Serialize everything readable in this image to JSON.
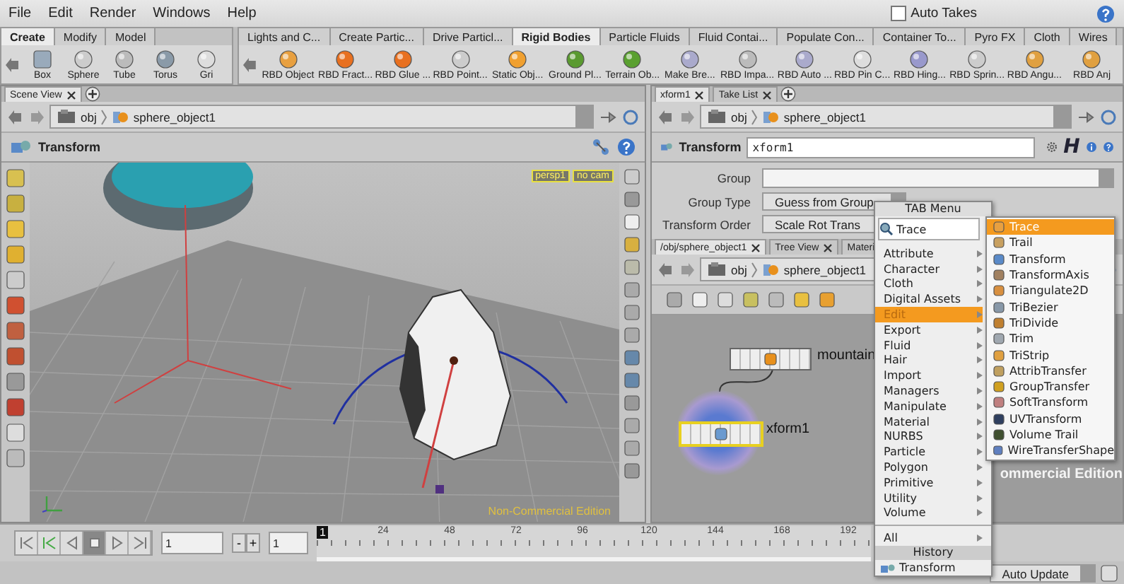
{
  "menubar": {
    "items": [
      "File",
      "Edit",
      "Render",
      "Windows",
      "Help"
    ],
    "auto_takes": {
      "label": "Auto Takes",
      "checked": false
    }
  },
  "shelf_left": {
    "tabs": [
      {
        "label": "Create",
        "selected": true
      },
      {
        "label": "Modify",
        "selected": false
      },
      {
        "label": "Model",
        "selected": false
      }
    ],
    "tools": [
      "Box",
      "Sphere",
      "Tube",
      "Torus",
      "Gri"
    ]
  },
  "shelf_right": {
    "tabs": [
      {
        "label": "Lights and C...",
        "selected": false
      },
      {
        "label": "Create Partic...",
        "selected": false
      },
      {
        "label": "Drive Particl...",
        "selected": false
      },
      {
        "label": "Rigid Bodies",
        "selected": true
      },
      {
        "label": "Particle Fluids",
        "selected": false
      },
      {
        "label": "Fluid Contai...",
        "selected": false
      },
      {
        "label": "Populate Con...",
        "selected": false
      },
      {
        "label": "Container To...",
        "selected": false
      },
      {
        "label": "Pyro FX",
        "selected": false
      },
      {
        "label": "Cloth",
        "selected": false
      },
      {
        "label": "Wires",
        "selected": false
      }
    ],
    "tools": [
      "RBD Object",
      "RBD Fract...",
      "RBD Glue ...",
      "RBD Point...",
      "Static Obj...",
      "Ground Pl...",
      "Terrain Ob...",
      "Make Bre...",
      "RBD Impa...",
      "RBD Auto ...",
      "RBD Pin C...",
      "RBD Hing...",
      "RBD Sprin...",
      "RBD Angu...",
      "RBD Anj"
    ]
  },
  "scene_pane": {
    "tabs": [
      {
        "label": "Scene View",
        "selected": true
      }
    ],
    "path": [
      "obj",
      "sphere_object1"
    ],
    "tool_title": "Transform",
    "camera_menus": [
      "persp1",
      "no cam"
    ],
    "edition_label": "Non-Commercial Edition"
  },
  "param_pane": {
    "tabs": [
      {
        "label": "xform1",
        "selected": true
      },
      {
        "label": "Take List",
        "selected": false
      }
    ],
    "path": [
      "obj",
      "sphere_object1"
    ],
    "node_type": "Transform",
    "node_name": "xform1",
    "h_button": "H",
    "params": [
      {
        "label": "Group",
        "kind": "field"
      },
      {
        "label": "Group Type",
        "kind": "menu",
        "value": "Guess from Group"
      },
      {
        "label": "Transform Order",
        "kind": "menu",
        "value": "Scale Rot Trans"
      }
    ]
  },
  "network_pane": {
    "tabs": [
      {
        "label": "/obj/sphere_object1",
        "selected": true
      },
      {
        "label": "Tree View",
        "selected": false
      },
      {
        "label": "Materi",
        "selected": false
      }
    ],
    "path": [
      "obj",
      "sphere_object1"
    ],
    "nodes": [
      {
        "name": "mountain",
        "selected": false
      },
      {
        "name": "xform1",
        "selected": true
      }
    ],
    "edition_label": "ommercial Edition"
  },
  "playbar": {
    "start_frame": "1",
    "minus": "-",
    "plus": "+",
    "current_frame": "1",
    "timeline_frame": "1",
    "ticks": [
      "24",
      "48",
      "72",
      "96",
      "120",
      "144",
      "168",
      "192"
    ]
  },
  "status": {
    "auto_update": "Auto Update"
  },
  "tab_menu": {
    "title": "TAB Menu",
    "search": "Trace",
    "categories": [
      {
        "label": "Attribute",
        "selected": false
      },
      {
        "label": "Character",
        "selected": false
      },
      {
        "label": "Cloth",
        "selected": false
      },
      {
        "label": "Digital Assets",
        "selected": false
      },
      {
        "label": "Edit",
        "selected": true
      },
      {
        "label": "Export",
        "selected": false
      },
      {
        "label": "Fluid",
        "selected": false
      },
      {
        "label": "Hair",
        "selected": false
      },
      {
        "label": "Import",
        "selected": false
      },
      {
        "label": "Managers",
        "selected": false
      },
      {
        "label": "Manipulate",
        "selected": false
      },
      {
        "label": "Material",
        "selected": false
      },
      {
        "label": "NURBS",
        "selected": false
      },
      {
        "label": "Particle",
        "selected": false
      },
      {
        "label": "Polygon",
        "selected": false
      },
      {
        "label": "Primitive",
        "selected": false
      },
      {
        "label": "Utility",
        "selected": false
      },
      {
        "label": "Volume",
        "selected": false
      }
    ],
    "all": "All",
    "history_title": "History",
    "history": [
      "Transform"
    ],
    "submenu": [
      {
        "label": "Trace",
        "selected": true
      },
      {
        "label": "Trail",
        "selected": false
      },
      {
        "label": "Transform",
        "selected": false
      },
      {
        "label": "TransformAxis",
        "selected": false
      },
      {
        "label": "Triangulate2D",
        "selected": false
      },
      {
        "label": "TriBezier",
        "selected": false
      },
      {
        "label": "TriDivide",
        "selected": false
      },
      {
        "label": "Trim",
        "selected": false
      },
      {
        "label": "TriStrip",
        "selected": false
      },
      {
        "label": "AttribTransfer",
        "selected": false
      },
      {
        "label": "GroupTransfer",
        "selected": false
      },
      {
        "label": "SoftTransform",
        "selected": false
      },
      {
        "label": "UVTransform",
        "selected": false
      },
      {
        "label": "Volume Trail",
        "selected": false
      },
      {
        "label": "WireTransferShape",
        "selected": false
      }
    ]
  }
}
